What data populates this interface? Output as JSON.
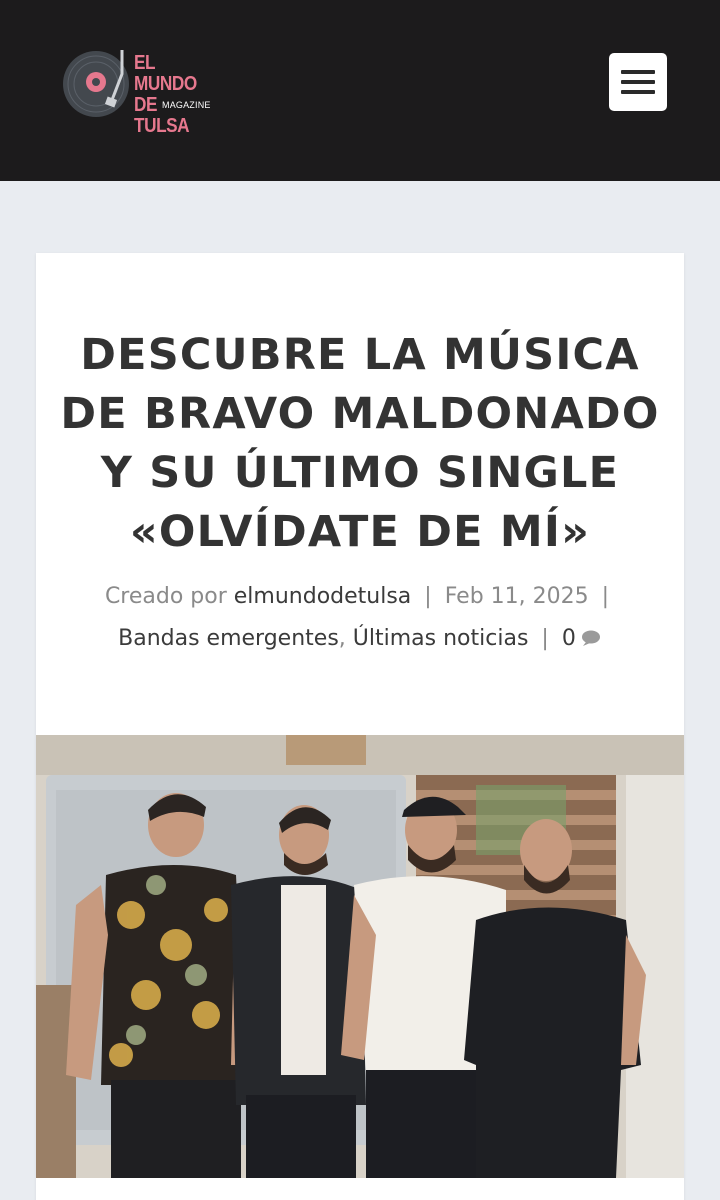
{
  "header": {
    "logo": {
      "line1": "EL MUNDO",
      "line2": "DE TULSA",
      "subtitle": "MAGAZINE",
      "icon": "vinyl-record-icon"
    },
    "menu_icon": "hamburger-menu-icon"
  },
  "article": {
    "title": "DESCUBRE LA MÚSICA DE BRAVO MALDONADO Y SU ÚLTIMO SINGLE «OLVÍDATE DE MÍ»",
    "meta": {
      "created_by_label": "Creado por",
      "author": "elmundodetulsa",
      "date": "Feb 11, 2025",
      "categories": [
        "Bandas emergentes",
        "Últimas noticias"
      ],
      "comments_count": "0",
      "comment_icon": "speech-bubble-icon",
      "separator": "|",
      "category_separator": ","
    },
    "featured_image": "band-photo-four-men"
  },
  "colors": {
    "header_bg": "#1c1b1c",
    "page_bg": "#e9ecf1",
    "logo_pink": "#e6788e",
    "title_text": "#333333",
    "meta_text": "#8a8a8a"
  }
}
